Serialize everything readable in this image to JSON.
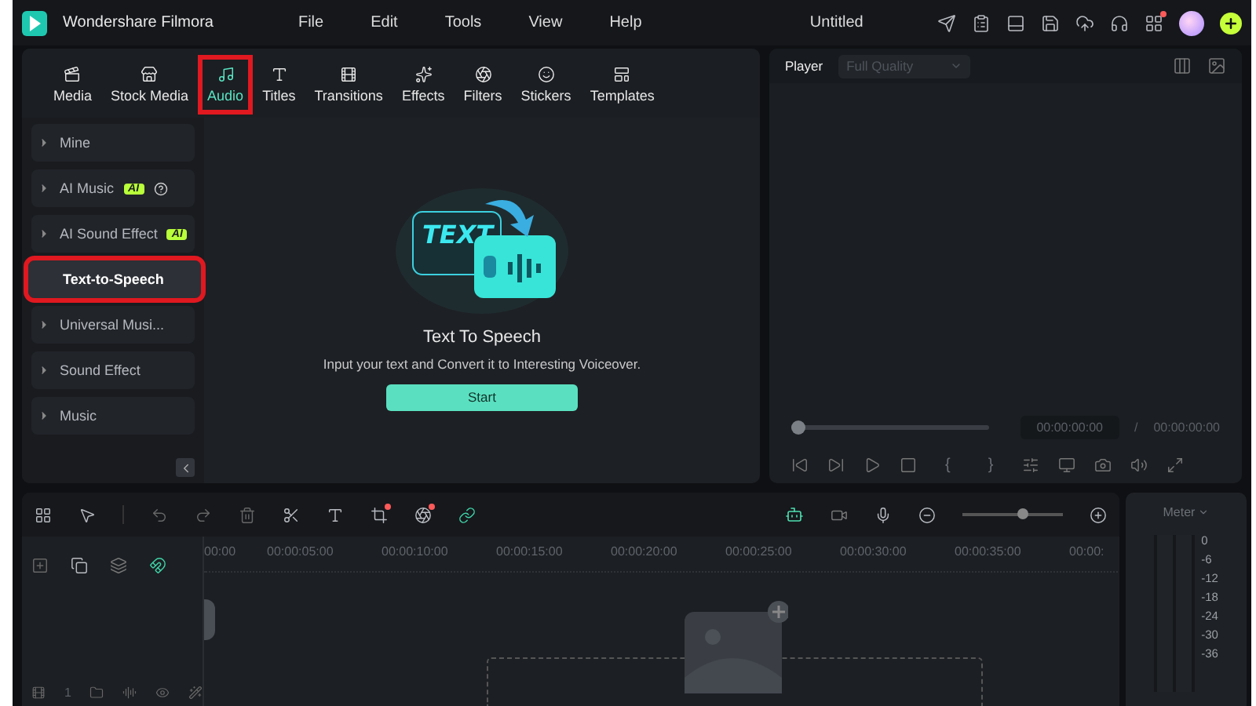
{
  "app": {
    "name": "Wondershare Filmora",
    "menu": [
      "File",
      "Edit",
      "Tools",
      "View",
      "Help"
    ],
    "document_title": "Untitled"
  },
  "media_tabs": [
    {
      "label": "Media",
      "selected": false,
      "highlighted": false
    },
    {
      "label": "Stock Media",
      "selected": false,
      "highlighted": false
    },
    {
      "label": "Audio",
      "selected": true,
      "highlighted": true
    },
    {
      "label": "Titles",
      "selected": false,
      "highlighted": false
    },
    {
      "label": "Transitions",
      "selected": false,
      "highlighted": false
    },
    {
      "label": "Effects",
      "selected": false,
      "highlighted": false
    },
    {
      "label": "Filters",
      "selected": false,
      "highlighted": false
    },
    {
      "label": "Stickers",
      "selected": false,
      "highlighted": false
    },
    {
      "label": "Templates",
      "selected": false,
      "highlighted": false
    }
  ],
  "sidebar": [
    {
      "label": "Mine",
      "kind": "folder",
      "selected": false,
      "highlighted": false
    },
    {
      "label": "AI Music",
      "kind": "folder",
      "badge": "AI",
      "help": true,
      "selected": false,
      "highlighted": false
    },
    {
      "label": "AI Sound Effect",
      "kind": "folder",
      "badge": "AI",
      "selected": false,
      "highlighted": false
    },
    {
      "label": "Text-to-Speech",
      "kind": "page",
      "selected": true,
      "highlighted": true
    },
    {
      "label": "Universal Musi...",
      "kind": "folder",
      "selected": false,
      "highlighted": false
    },
    {
      "label": "Sound Effect",
      "kind": "folder",
      "selected": false,
      "highlighted": false
    },
    {
      "label": "Music",
      "kind": "folder",
      "selected": false,
      "highlighted": false
    }
  ],
  "tts": {
    "illustration_text": "TEXT",
    "title": "Text To Speech",
    "description": "Input your text and Convert it to Interesting Voiceover.",
    "button": "Start"
  },
  "player": {
    "label": "Player",
    "quality": "Full Quality",
    "quality_disabled": true,
    "level": 0,
    "current_time": "00:00:00:00",
    "separator": "/",
    "total_time": "00:00:00:00",
    "mark_in": "{",
    "mark_out": "}"
  },
  "timeline": {
    "zoom": {
      "level": 0.6
    },
    "ruler": [
      "00:00",
      "00:00:05:00",
      "00:00:10:00",
      "00:00:15:00",
      "00:00:20:00",
      "00:00:25:00",
      "00:00:30:00",
      "00:00:35:00",
      "00:00:"
    ],
    "track_number": "1"
  },
  "meter": {
    "label": "Meter",
    "scale": [
      "0",
      "-6",
      "-12",
      "-18",
      "-24",
      "-30",
      "-36"
    ]
  }
}
